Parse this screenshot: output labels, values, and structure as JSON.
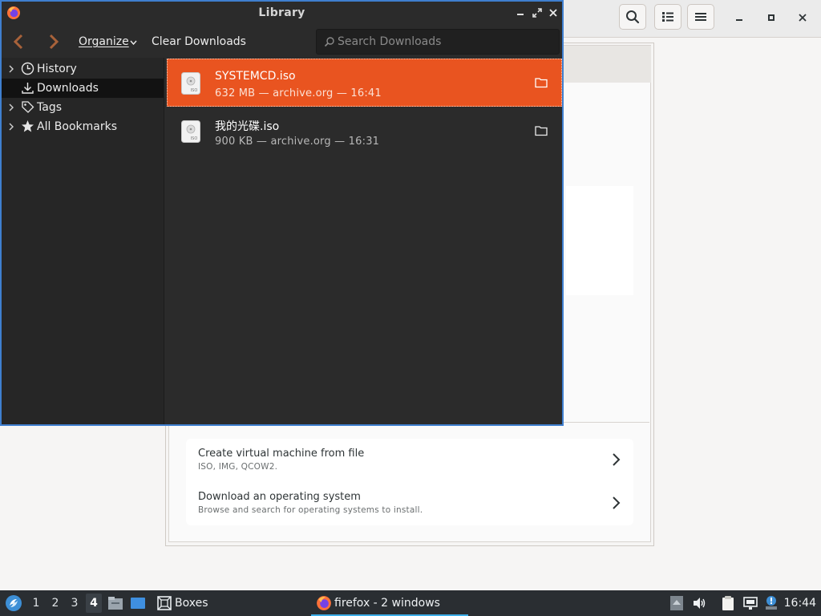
{
  "library": {
    "title": "Library",
    "toolbar": {
      "organize": "Organize",
      "clear_downloads": "Clear Downloads",
      "search_placeholder": "Search Downloads"
    },
    "sidebar": {
      "items": [
        {
          "label": "History",
          "icon": "clock-icon",
          "expandable": true
        },
        {
          "label": "Downloads",
          "icon": "download-icon",
          "expandable": false,
          "selected": true
        },
        {
          "label": "Tags",
          "icon": "tag-icon",
          "expandable": true
        },
        {
          "label": "All Bookmarks",
          "icon": "star-icon",
          "expandable": true
        }
      ]
    },
    "downloads": [
      {
        "name": "SYSTEMCD.iso",
        "meta": "632 MB — archive.org — 16:41",
        "file_icon_label": "ISO",
        "selected": true
      },
      {
        "name": "我的光碟.iso",
        "meta": "900 KB — archive.org — 16:31",
        "file_icon_label": "ISO",
        "selected": false
      }
    ]
  },
  "boxes": {
    "options": [
      {
        "title": "Create virtual machine from file",
        "subtitle": "ISO, IMG, QCOW2."
      },
      {
        "title": "Download an operating system",
        "subtitle": "Browse and search for operating systems to install."
      }
    ]
  },
  "taskbar": {
    "desktops": [
      "1",
      "2",
      "3",
      "4"
    ],
    "active_desktop": "4",
    "boxes_label": "Boxes",
    "task_label": "firefox - 2 windows",
    "clock": "16:44"
  },
  "colors": {
    "accent": "#e95420",
    "focus_border": "#3f7fcf",
    "taskbar_bg": "#2a2e32",
    "taskbar_highlight": "#3daee9"
  }
}
